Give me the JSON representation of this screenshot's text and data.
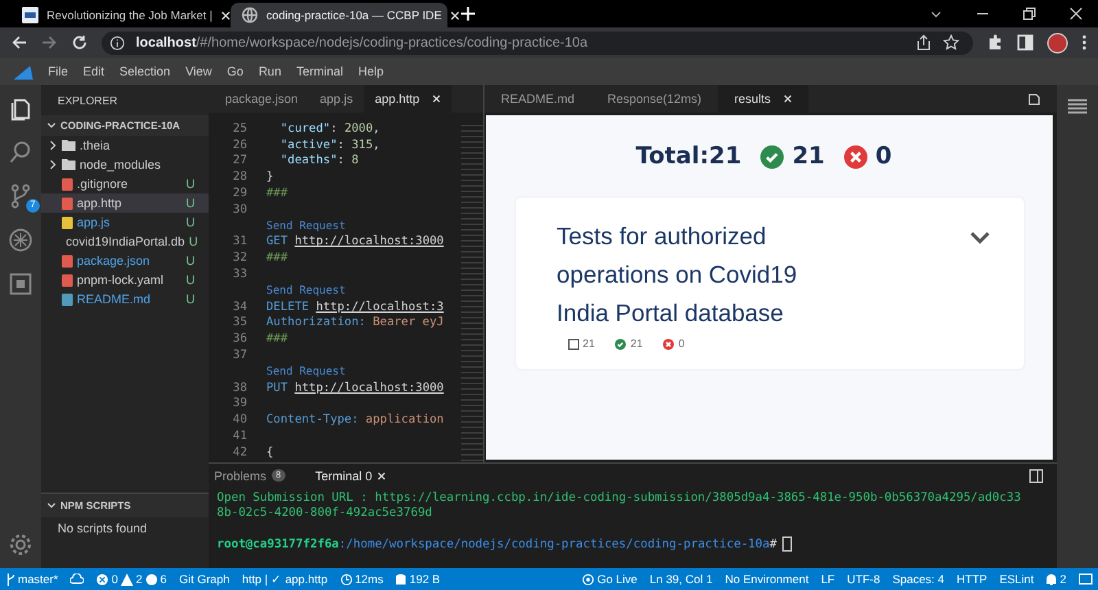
{
  "browser": {
    "tabs": [
      {
        "title": "Revolutionizing the Job Market |",
        "kind": "site",
        "selected": false
      },
      {
        "title": "coding-practice-10a — CCBP IDE",
        "kind": "globe",
        "selected": true
      }
    ],
    "url_host": "localhost",
    "url_path": "/#/home/workspace/nodejs/coding-practices/coding-practice-10a"
  },
  "menu": [
    "File",
    "Edit",
    "Selection",
    "View",
    "Go",
    "Run",
    "Terminal",
    "Help"
  ],
  "activity_bar": {
    "source_control_badge": "7"
  },
  "sidebar": {
    "title": "EXPLORER",
    "project": "CODING-PRACTICE-10A",
    "items": [
      {
        "name": ".theia",
        "kind": "folder",
        "selected": false
      },
      {
        "name": "node_modules",
        "kind": "folder",
        "selected": false
      },
      {
        "name": ".gitignore",
        "kind": "gitignore",
        "status": "U",
        "color": "#cccccc",
        "selected": false
      },
      {
        "name": "app.http",
        "kind": "http",
        "status": "U",
        "color": "#cccccc",
        "selected": true
      },
      {
        "name": "app.js",
        "kind": "js",
        "status": "U",
        "color": "#4fa3e8",
        "selected": false
      },
      {
        "name": "covid19IndiaPortal.db",
        "kind": "db",
        "status": "U",
        "color": "#cccccc",
        "selected": false
      },
      {
        "name": "package.json",
        "kind": "json",
        "status": "U",
        "color": "#4fa3e8",
        "selected": false
      },
      {
        "name": "pnpm-lock.yaml",
        "kind": "yaml",
        "status": "U",
        "color": "#cccccc",
        "selected": false
      },
      {
        "name": "README.md",
        "kind": "md",
        "status": "U",
        "color": "#4fa3e8",
        "selected": false
      }
    ],
    "npm_title": "NPM SCRIPTS",
    "npm_message": "No scripts found"
  },
  "editor": {
    "tabs": [
      {
        "label": "package.json",
        "selected": false
      },
      {
        "label": "app.js",
        "selected": false
      },
      {
        "label": "app.http",
        "selected": true
      }
    ],
    "lines": [
      {
        "num": "25",
        "tokens": [
          {
            "kind": "key",
            "text": "  \"cured\""
          },
          {
            "kind": "plain",
            "text": ": "
          },
          {
            "kind": "number",
            "text": "2000"
          },
          {
            "kind": "plain",
            "text": ","
          }
        ]
      },
      {
        "num": "26",
        "tokens": [
          {
            "kind": "key",
            "text": "  \"active\""
          },
          {
            "kind": "plain",
            "text": ": "
          },
          {
            "kind": "number",
            "text": "315"
          },
          {
            "kind": "plain",
            "text": ","
          }
        ]
      },
      {
        "num": "27",
        "tokens": [
          {
            "kind": "key",
            "text": "  \"deaths\""
          },
          {
            "kind": "plain",
            "text": ": "
          },
          {
            "kind": "number",
            "text": "8"
          }
        ]
      },
      {
        "num": "28",
        "tokens": [
          {
            "kind": "plain",
            "text": "}"
          }
        ]
      },
      {
        "num": "29",
        "tokens": [
          {
            "kind": "comment",
            "text": "###"
          }
        ]
      },
      {
        "num": "30"
      },
      {
        "lens": "Send Request"
      },
      {
        "num": "31",
        "tokens": [
          {
            "kind": "method",
            "text": "GET"
          },
          {
            "kind": "url",
            "text": "http://localhost:3000"
          }
        ]
      },
      {
        "num": "32",
        "tokens": [
          {
            "kind": "comment",
            "text": "###"
          }
        ]
      },
      {
        "num": "33"
      },
      {
        "lens": "Send Request"
      },
      {
        "num": "34",
        "tokens": [
          {
            "kind": "method",
            "text": "DELETE"
          },
          {
            "kind": "url",
            "text": "http://localhost:3"
          }
        ]
      },
      {
        "num": "35",
        "tokens": [
          {
            "kind": "header",
            "text": "Authorization:"
          },
          {
            "kind": "value",
            "text": "Bearer eyJ"
          }
        ]
      },
      {
        "num": "36",
        "tokens": [
          {
            "kind": "comment",
            "text": "###"
          }
        ]
      },
      {
        "num": "37"
      },
      {
        "lens": "Send Request"
      },
      {
        "num": "38",
        "tokens": [
          {
            "kind": "method",
            "text": "PUT"
          },
          {
            "kind": "url",
            "text": "http://localhost:3000"
          }
        ]
      },
      {
        "num": "39"
      },
      {
        "num": "40",
        "tokens": [
          {
            "kind": "header",
            "text": "Content-Type:"
          },
          {
            "kind": "value",
            "text": "application"
          }
        ]
      },
      {
        "num": "41"
      },
      {
        "num": "42",
        "tokens": [
          {
            "kind": "plain",
            "text": "{"
          }
        ]
      }
    ]
  },
  "preview": {
    "tabs": [
      {
        "label": "README.md",
        "selected": false
      },
      {
        "label": "Response(12ms)",
        "selected": false
      },
      {
        "label": "results",
        "selected": true
      }
    ],
    "total": "Total:21",
    "passed": "21",
    "failed": "0",
    "card": {
      "title": "Tests for authorized operations on Covid19 India Portal database",
      "expanded": false,
      "total": "21",
      "passed": "21",
      "failed": "0"
    }
  },
  "panel": {
    "tabs": [
      {
        "label": "Problems",
        "badge": "8",
        "selected": false
      },
      {
        "label": "Terminal 0",
        "selected": true
      }
    ],
    "output": "Open Submission URL : https://learning.ccbp.in/ide-coding-submission/3805d9a4-3865-481e-950b-0b56370a4295/ad0c338b-02c5-4200-800f-492ac5e3769d",
    "prompt_user": "root@ca93177f2f6a",
    "prompt_path": ":/home/workspace/nodejs/coding-practices/coding-practice-10a",
    "prompt_sign": "#"
  },
  "status_bar": {
    "left": [
      {
        "kind": "branch",
        "text": "master*"
      },
      {
        "kind": "sync"
      },
      {
        "kind": "problems",
        "errors": "0",
        "warnings": "2",
        "infos": "6"
      },
      {
        "text": "Git Graph"
      },
      {
        "text": "http | ✓ app.http"
      },
      {
        "kind": "clock",
        "text": "12ms"
      },
      {
        "kind": "db",
        "text": "192 B"
      }
    ],
    "right": [
      {
        "kind": "broadcast",
        "text": "Go Live"
      },
      {
        "text": "Ln 39, Col 1"
      },
      {
        "text": "No Environment"
      },
      {
        "text": "LF"
      },
      {
        "text": "UTF-8"
      },
      {
        "text": "Spaces: 4"
      },
      {
        "text": "HTTP"
      },
      {
        "text": "ESLint"
      },
      {
        "kind": "bell",
        "text": "2"
      },
      {
        "kind": "feedback"
      }
    ]
  }
}
